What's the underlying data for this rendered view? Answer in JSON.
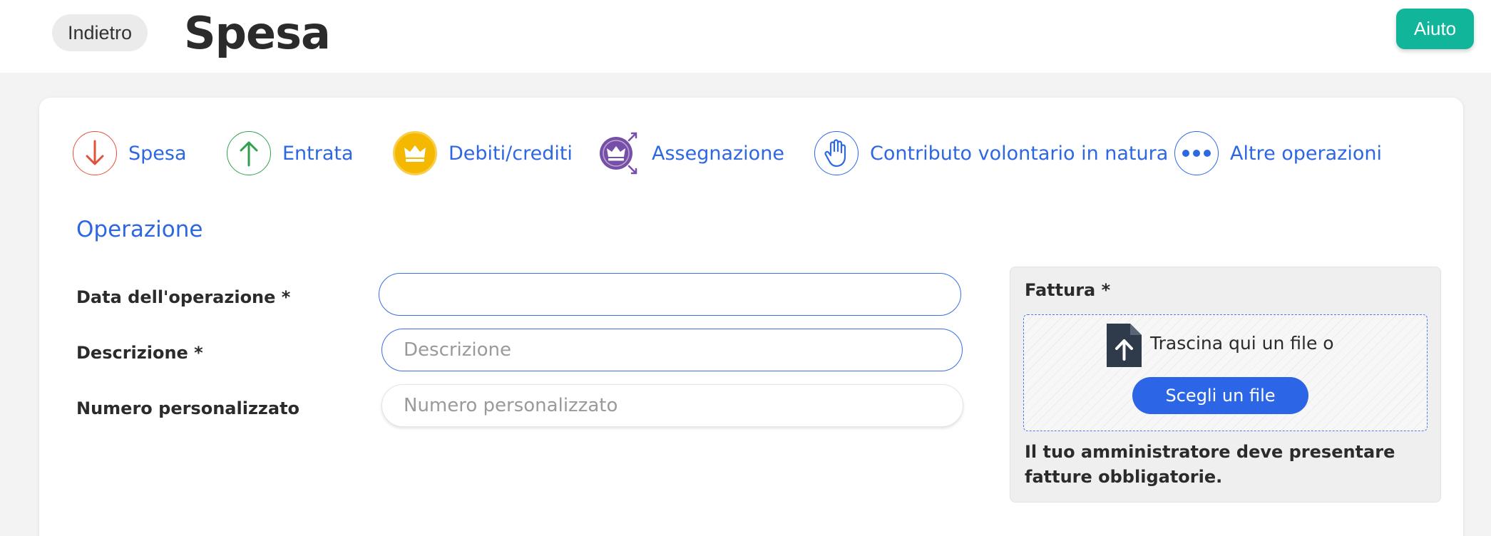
{
  "header": {
    "back_label": "Indietro",
    "title": "Spesa",
    "help_label": "Aiuto"
  },
  "operation_types": [
    {
      "label": "Spesa",
      "icon": "arrow-down-icon",
      "color": "#e0523a"
    },
    {
      "label": "Entrata",
      "icon": "arrow-up-icon",
      "color": "#2fa14c"
    },
    {
      "label": "Debiti/crediti",
      "icon": "crown-icon",
      "color": "#f5b800"
    },
    {
      "label": "Assegnazione",
      "icon": "crown-expand-icon",
      "color": "#7650a8"
    },
    {
      "label": "Contributo volontario in natura",
      "icon": "hand-icon",
      "color": "#2d67e2"
    },
    {
      "label": "Altre operazioni",
      "icon": "more-dots-icon",
      "color": "#2d67e2"
    }
  ],
  "form": {
    "section_title": "Operazione",
    "fields": [
      {
        "label": "Data dell'operazione *",
        "value": "",
        "placeholder": ""
      },
      {
        "label": "Descrizione *",
        "value": "",
        "placeholder": "Descrizione"
      },
      {
        "label": "Numero personalizzato",
        "value": "",
        "placeholder": "Numero personalizzato"
      }
    ]
  },
  "attachment": {
    "title": "Fattura *",
    "drop_text": "Trascina qui un file o",
    "choose_label": "Scegli un file",
    "note": "Il tuo amministratore deve presentare fatture obbligatorie."
  },
  "colors": {
    "accent": "#2d67e2",
    "help_button": "#11b59a"
  }
}
